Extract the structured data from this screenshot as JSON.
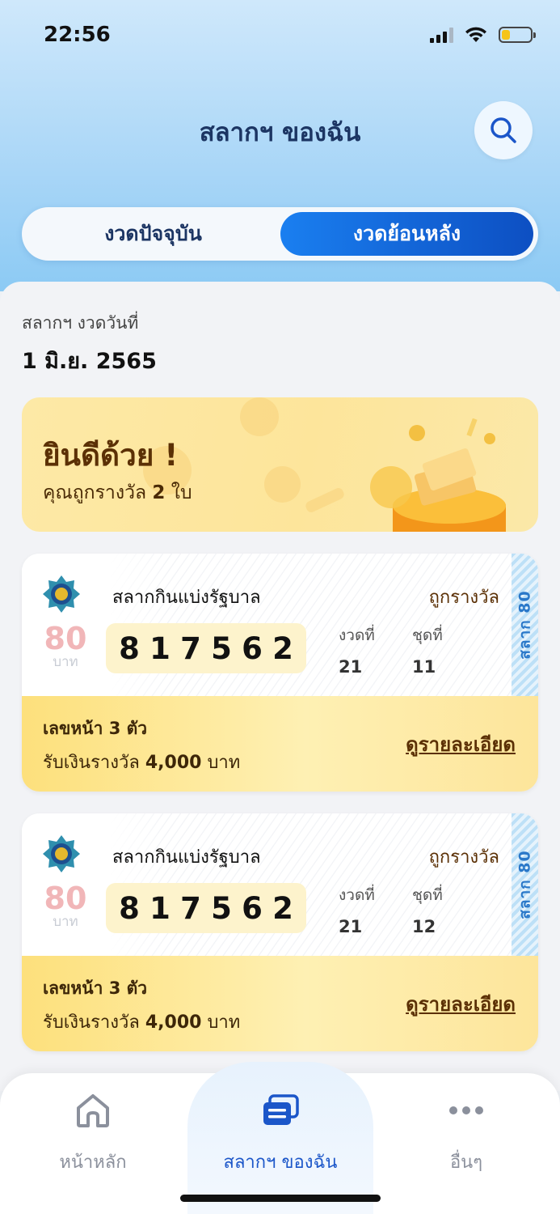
{
  "status_bar": {
    "time": "22:56"
  },
  "header": {
    "title": "สลากฯ ของฉัน",
    "search_icon": "search-icon"
  },
  "tabs": {
    "current": "งวดปัจจุบัน",
    "past": "งวดย้อนหลัง",
    "selected": "past"
  },
  "draw": {
    "label": "สลากฯ งวดวันที่",
    "date": "1 มิ.ย. 2565"
  },
  "congrats": {
    "title": "ยินดีด้วย !",
    "sub_prefix": "คุณถูกรางวัล",
    "count": "2",
    "sub_suffix": "ใบ"
  },
  "tickets": [
    {
      "name": "สลากกินแบ่งรัฐบาล",
      "status": "ถูกรางวัล",
      "price": "80",
      "price_unit": "บาท",
      "digits": [
        "8",
        "1",
        "7",
        "5",
        "6",
        "2"
      ],
      "draw_label": "งวดที่",
      "draw_no": "21",
      "set_label": "ชุดที่",
      "set_no": "11",
      "side_label": "สลาก 80",
      "prize_name": "เลขหน้า 3 ตัว",
      "prize_prefix": "รับเงินรางวัล",
      "prize_amount": "4,000",
      "prize_suffix": "บาท",
      "detail_link": "ดูรายละเอียด"
    },
    {
      "name": "สลากกินแบ่งรัฐบาล",
      "status": "ถูกรางวัล",
      "price": "80",
      "price_unit": "บาท",
      "digits": [
        "8",
        "1",
        "7",
        "5",
        "6",
        "2"
      ],
      "draw_label": "งวดที่",
      "draw_no": "21",
      "set_label": "ชุดที่",
      "set_no": "12",
      "side_label": "สลาก 80",
      "prize_name": "เลขหน้า 3 ตัว",
      "prize_prefix": "รับเงินรางวัล",
      "prize_amount": "4,000",
      "prize_suffix": "บาท",
      "detail_link": "ดูรายละเอียด"
    }
  ],
  "bottom_nav": [
    {
      "label": "หน้าหลัก",
      "icon": "home-icon",
      "active": false
    },
    {
      "label": "สลากฯ ของฉัน",
      "icon": "ticket-icon",
      "active": true
    },
    {
      "label": "อื่นๆ",
      "icon": "more-icon",
      "active": false
    }
  ],
  "colors": {
    "accent": "#1b56c9",
    "gold": "#5b3005",
    "banner": "#fde9a6"
  }
}
